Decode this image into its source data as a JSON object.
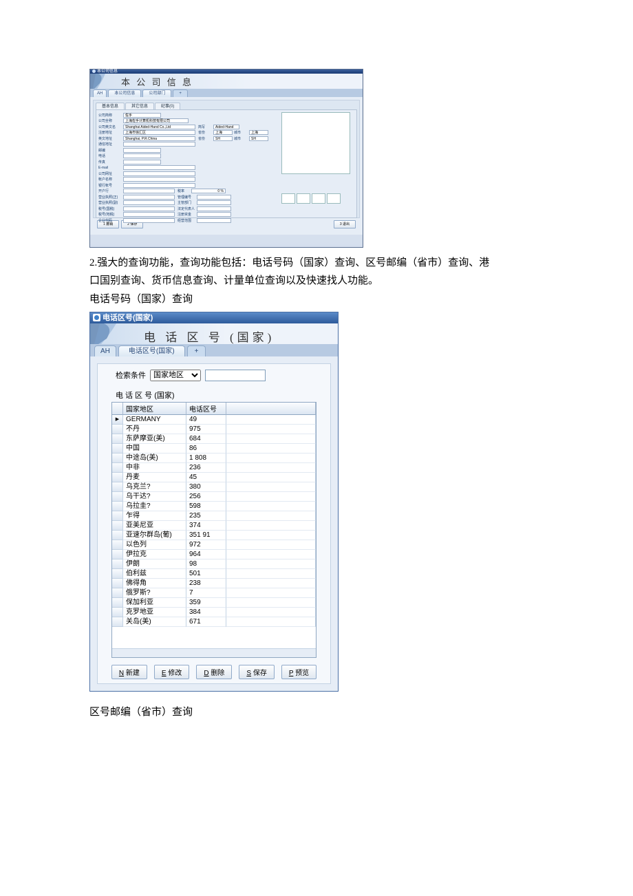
{
  "win1": {
    "titlebar": "本公司信息",
    "header": "本 公 司 信 息",
    "tabs": {
      "ah": "AH",
      "t1": "本公司信息",
      "t2": "公司部门",
      "plus": "+"
    },
    "subtabs": {
      "s1": "基本信息",
      "s2": "其它信息",
      "s3": "纪事(0)"
    },
    "labels": {
      "abbr": "公司简称",
      "full": "公司全称",
      "en": "公司英文名",
      "addr": "注册地址",
      "addrEn": "英文地址",
      "mail": "通信地址",
      "post": "邮编",
      "tel": "电话",
      "fax": "传真",
      "email": "E-mail",
      "web": "公司网址",
      "acctName": "帐户名称",
      "bankAcct": "银行帐号",
      "bank": "开户行",
      "lic1": "营业执照(正)",
      "lic2": "营业执照(副)",
      "taxN": "税号(国税)",
      "taxL": "税号(地税)",
      "code": "企业代码",
      "abbrEn": "简写",
      "province": "省份",
      "city": "城市",
      "province2": "省份",
      "city2": "城市",
      "rate": "税率",
      "mgmt": "管理编号",
      "dept": "主管部门",
      "legal": "法定代表人",
      "regCap": "注册资金",
      "scope": "经营范围"
    },
    "values": {
      "abbr": "佐手",
      "full": "上海佐手计算机科技有限公司",
      "en": "Shanghai Aided-Hand Co.,Ltd",
      "addr": "上海市徐汇区",
      "addrEn": "Shanghai, P.R.China",
      "abbrEn": "Aided-Hand",
      "province": "上海",
      "city": "上海",
      "province2": "SH",
      "city2": "SH",
      "rate": "0 %"
    },
    "buttons": {
      "undo": "1 撤销",
      "save": "2 保存",
      "exit": "3 退出"
    }
  },
  "doc": {
    "p1a": "2.强大的查询功能，查询功能包括：电话号码（国家）查询、区号邮编（省市）查询、港",
    "p1b": "口国别查询、货币信息查询、计量单位查询以及快速找人功能。",
    "p2": "电话号码（国家）查询",
    "p3": "区号邮编（省市）查询"
  },
  "win2": {
    "titlebar": "电话区号(国家)",
    "header": "电 话 区 号 (国家)",
    "tabs": {
      "ah": "AH",
      "t1": "电话区号(国家)",
      "plus": "+"
    },
    "search": {
      "lbl": "检索条件",
      "sel": "国家地区"
    },
    "tableTitle": "电 话 区 号 (国家)",
    "headers": {
      "c1": "国家地区",
      "c2": "电话区号"
    },
    "rows": [
      {
        "c1": "GERMANY",
        "c2": "49",
        "ptr": true
      },
      {
        "c1": "不丹",
        "c2": "975"
      },
      {
        "c1": "东萨摩亚(美)",
        "c2": "684"
      },
      {
        "c1": "中国",
        "c2": "86"
      },
      {
        "c1": "中途岛(美)",
        "c2": "1 808"
      },
      {
        "c1": "中非",
        "c2": "236"
      },
      {
        "c1": "丹麦",
        "c2": "45"
      },
      {
        "c1": "乌克兰?",
        "c2": "380"
      },
      {
        "c1": "乌干达?",
        "c2": "256"
      },
      {
        "c1": "乌拉圭?",
        "c2": "598"
      },
      {
        "c1": "乍得",
        "c2": "235"
      },
      {
        "c1": "亚美尼亚",
        "c2": "374"
      },
      {
        "c1": "亚速尔群岛(葡)",
        "c2": "351 91"
      },
      {
        "c1": "以色列",
        "c2": "972"
      },
      {
        "c1": "伊拉克",
        "c2": "964"
      },
      {
        "c1": "伊朗",
        "c2": "98"
      },
      {
        "c1": "伯利兹",
        "c2": "501"
      },
      {
        "c1": "佛得角",
        "c2": "238"
      },
      {
        "c1": "俄罗斯?",
        "c2": "7"
      },
      {
        "c1": "保加利亚",
        "c2": "359"
      },
      {
        "c1": "克罗地亚",
        "c2": "384"
      },
      {
        "c1": "关岛(美)",
        "c2": "671"
      }
    ],
    "buttons": {
      "new": "N 新建",
      "edit": "E 修改",
      "del": "D 删除",
      "save": "S 保存",
      "prev": "P 预览"
    }
  }
}
